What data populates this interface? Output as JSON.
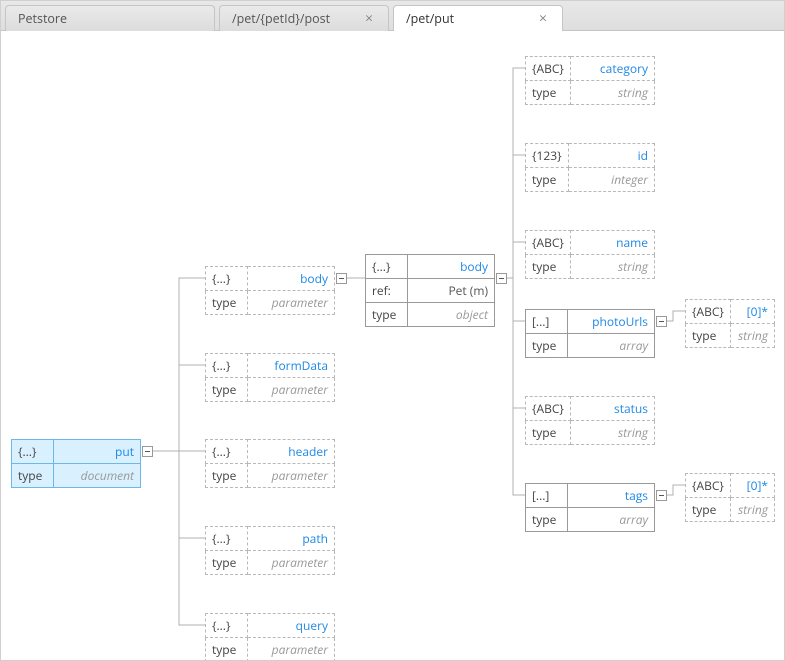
{
  "tabs": {
    "root": "Petstore",
    "inactive": "/pet/{petId}/post",
    "active": "/pet/put"
  },
  "root": {
    "icon": "{...}",
    "name": "put",
    "typeKey": "type",
    "typeVal": "document"
  },
  "params": [
    {
      "icon": "{...}",
      "name": "body",
      "typeKey": "type",
      "typeVal": "parameter"
    },
    {
      "icon": "{...}",
      "name": "formData",
      "typeKey": "type",
      "typeVal": "parameter"
    },
    {
      "icon": "{...}",
      "name": "header",
      "typeKey": "type",
      "typeVal": "parameter"
    },
    {
      "icon": "{...}",
      "name": "path",
      "typeKey": "type",
      "typeVal": "parameter"
    },
    {
      "icon": "{...}",
      "name": "query",
      "typeKey": "type",
      "typeVal": "parameter"
    }
  ],
  "bodyObj": {
    "icon": "{...}",
    "name": "body",
    "refKey": "ref:",
    "refVal": "Pet (m)",
    "typeKey": "type",
    "typeVal": "object"
  },
  "props": [
    {
      "icon": "{ABC}",
      "name": "category",
      "typeKey": "type",
      "typeVal": "string"
    },
    {
      "icon": "{123}",
      "name": "id",
      "typeKey": "type",
      "typeVal": "integer"
    },
    {
      "icon": "{ABC}",
      "name": "name",
      "typeKey": "type",
      "typeVal": "string"
    },
    {
      "icon": "[...]",
      "name": "photoUrls",
      "typeKey": "type",
      "typeVal": "array"
    },
    {
      "icon": "{ABC}",
      "name": "status",
      "typeKey": "type",
      "typeVal": "string"
    },
    {
      "icon": "[...]",
      "name": "tags",
      "typeKey": "type",
      "typeVal": "array"
    }
  ],
  "arrayItems": [
    {
      "icon": "{ABC}",
      "name": "[0]*",
      "typeKey": "type",
      "typeVal": "string"
    },
    {
      "icon": "{ABC}",
      "name": "[0]*",
      "typeKey": "type",
      "typeVal": "string"
    }
  ]
}
